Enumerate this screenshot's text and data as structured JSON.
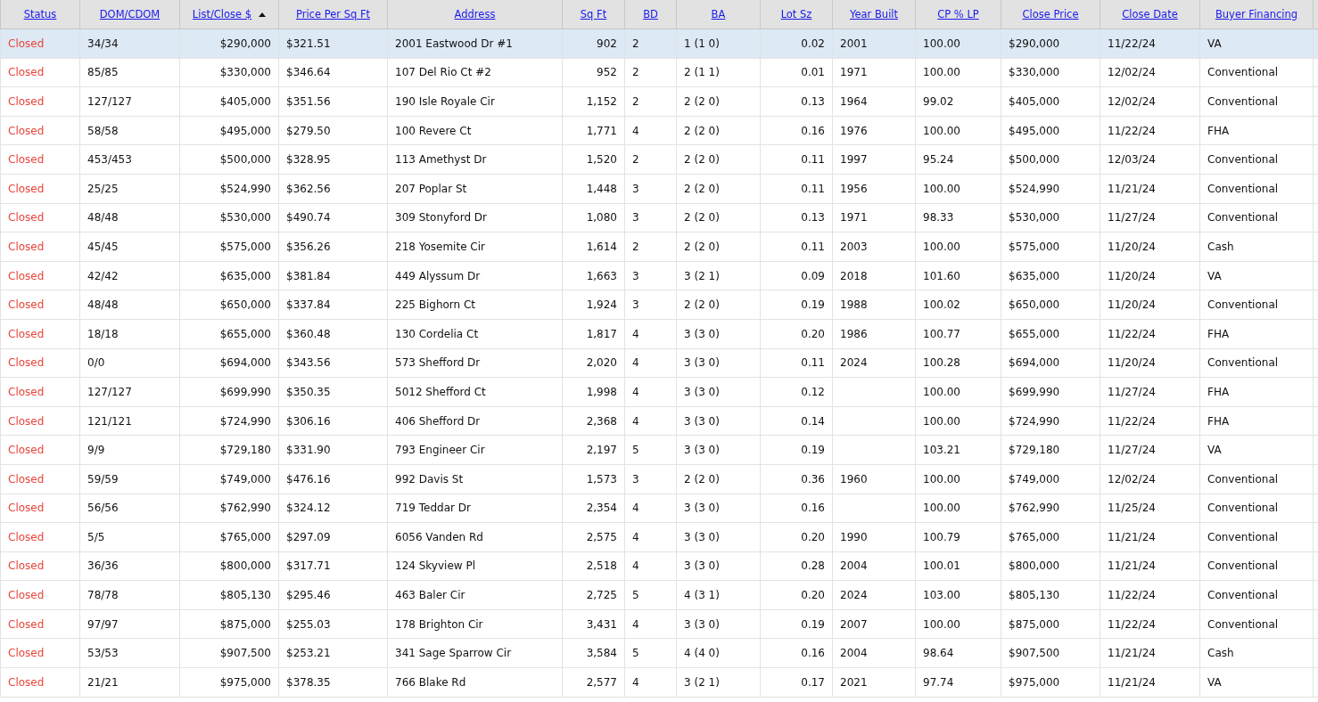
{
  "table": {
    "columns": [
      {
        "label": "Status",
        "kind": "status",
        "sorted": false
      },
      {
        "label": "DOM/CDOM",
        "kind": "text",
        "sorted": false
      },
      {
        "label": "List/Close $",
        "kind": "number",
        "sorted": true
      },
      {
        "label": "Price Per Sq Ft",
        "kind": "text",
        "sorted": false
      },
      {
        "label": "Address",
        "kind": "text",
        "sorted": false
      },
      {
        "label": "Sq Ft",
        "kind": "number",
        "sorted": false
      },
      {
        "label": "BD",
        "kind": "text",
        "sorted": false
      },
      {
        "label": "BA",
        "kind": "text",
        "sorted": false
      },
      {
        "label": "Lot Sz",
        "kind": "number",
        "sorted": false
      },
      {
        "label": "Year Built",
        "kind": "text",
        "sorted": false
      },
      {
        "label": "CP % LP",
        "kind": "text",
        "sorted": false
      },
      {
        "label": "Close Price",
        "kind": "text",
        "sorted": false
      },
      {
        "label": "Close Date",
        "kind": "text",
        "sorted": false
      },
      {
        "label": "Buyer Financing",
        "kind": "text",
        "sorted": false
      }
    ],
    "rows": [
      {
        "selected": true,
        "cells": [
          "Closed",
          "34/34",
          "$290,000",
          "$321.51",
          "2001 Eastwood Dr #1",
          "902",
          "2",
          "1 (1 0)",
          "0.02",
          "2001",
          "100.00",
          "$290,000",
          "11/22/24",
          "VA"
        ]
      },
      {
        "selected": false,
        "cells": [
          "Closed",
          "85/85",
          "$330,000",
          "$346.64",
          "107 Del Rio Ct #2",
          "952",
          "2",
          "2 (1 1)",
          "0.01",
          "1971",
          "100.00",
          "$330,000",
          "12/02/24",
          "Conventional"
        ]
      },
      {
        "selected": false,
        "cells": [
          "Closed",
          "127/127",
          "$405,000",
          "$351.56",
          "190 Isle Royale Cir",
          "1,152",
          "2",
          "2 (2 0)",
          "0.13",
          "1964",
          "99.02",
          "$405,000",
          "12/02/24",
          "Conventional"
        ]
      },
      {
        "selected": false,
        "cells": [
          "Closed",
          "58/58",
          "$495,000",
          "$279.50",
          "100 Revere Ct",
          "1,771",
          "4",
          "2 (2 0)",
          "0.16",
          "1976",
          "100.00",
          "$495,000",
          "11/22/24",
          "FHA"
        ]
      },
      {
        "selected": false,
        "cells": [
          "Closed",
          "453/453",
          "$500,000",
          "$328.95",
          "113 Amethyst Dr",
          "1,520",
          "2",
          "2 (2 0)",
          "0.11",
          "1997",
          "95.24",
          "$500,000",
          "12/03/24",
          "Conventional"
        ]
      },
      {
        "selected": false,
        "cells": [
          "Closed",
          "25/25",
          "$524,990",
          "$362.56",
          "207 Poplar St",
          "1,448",
          "3",
          "2 (2 0)",
          "0.11",
          "1956",
          "100.00",
          "$524,990",
          "11/21/24",
          "Conventional"
        ]
      },
      {
        "selected": false,
        "cells": [
          "Closed",
          "48/48",
          "$530,000",
          "$490.74",
          "309 Stonyford Dr",
          "1,080",
          "3",
          "2 (2 0)",
          "0.13",
          "1971",
          "98.33",
          "$530,000",
          "11/27/24",
          "Conventional"
        ]
      },
      {
        "selected": false,
        "cells": [
          "Closed",
          "45/45",
          "$575,000",
          "$356.26",
          "218 Yosemite Cir",
          "1,614",
          "2",
          "2 (2 0)",
          "0.11",
          "2003",
          "100.00",
          "$575,000",
          "11/20/24",
          "Cash"
        ]
      },
      {
        "selected": false,
        "cells": [
          "Closed",
          "42/42",
          "$635,000",
          "$381.84",
          "449 Alyssum Dr",
          "1,663",
          "3",
          "3 (2 1)",
          "0.09",
          "2018",
          "101.60",
          "$635,000",
          "11/20/24",
          "VA"
        ]
      },
      {
        "selected": false,
        "cells": [
          "Closed",
          "48/48",
          "$650,000",
          "$337.84",
          "225 Bighorn Ct",
          "1,924",
          "3",
          "2 (2 0)",
          "0.19",
          "1988",
          "100.02",
          "$650,000",
          "11/20/24",
          "Conventional"
        ]
      },
      {
        "selected": false,
        "cells": [
          "Closed",
          "18/18",
          "$655,000",
          "$360.48",
          "130 Cordelia Ct",
          "1,817",
          "4",
          "3 (3 0)",
          "0.20",
          "1986",
          "100.77",
          "$655,000",
          "11/22/24",
          "FHA"
        ]
      },
      {
        "selected": false,
        "cells": [
          "Closed",
          "0/0",
          "$694,000",
          "$343.56",
          "573 Shefford Dr",
          "2,020",
          "4",
          "3 (3 0)",
          "0.11",
          "2024",
          "100.28",
          "$694,000",
          "11/20/24",
          "Conventional"
        ]
      },
      {
        "selected": false,
        "cells": [
          "Closed",
          "127/127",
          "$699,990",
          "$350.35",
          "5012 Shefford Ct",
          "1,998",
          "4",
          "3 (3 0)",
          "0.12",
          null,
          "100.00",
          "$699,990",
          "11/27/24",
          "FHA"
        ]
      },
      {
        "selected": false,
        "cells": [
          "Closed",
          "121/121",
          "$724,990",
          "$306.16",
          "406 Shefford Dr",
          "2,368",
          "4",
          "3 (3 0)",
          "0.14",
          null,
          "100.00",
          "$724,990",
          "11/22/24",
          "FHA"
        ]
      },
      {
        "selected": false,
        "cells": [
          "Closed",
          "9/9",
          "$729,180",
          "$331.90",
          "793 Engineer Cir",
          "2,197",
          "5",
          "3 (3 0)",
          "0.19",
          null,
          "103.21",
          "$729,180",
          "11/27/24",
          "VA"
        ]
      },
      {
        "selected": false,
        "cells": [
          "Closed",
          "59/59",
          "$749,000",
          "$476.16",
          "992 Davis St",
          "1,573",
          "3",
          "2 (2 0)",
          "0.36",
          "1960",
          "100.00",
          "$749,000",
          "12/02/24",
          "Conventional"
        ]
      },
      {
        "selected": false,
        "cells": [
          "Closed",
          "56/56",
          "$762,990",
          "$324.12",
          "719 Teddar Dr",
          "2,354",
          "4",
          "3 (3 0)",
          "0.16",
          null,
          "100.00",
          "$762,990",
          "11/25/24",
          "Conventional"
        ]
      },
      {
        "selected": false,
        "cells": [
          "Closed",
          "5/5",
          "$765,000",
          "$297.09",
          "6056 Vanden Rd",
          "2,575",
          "4",
          "3 (3 0)",
          "0.20",
          "1990",
          "100.79",
          "$765,000",
          "11/21/24",
          "Conventional"
        ]
      },
      {
        "selected": false,
        "cells": [
          "Closed",
          "36/36",
          "$800,000",
          "$317.71",
          "124 Skyview Pl",
          "2,518",
          "4",
          "3 (3 0)",
          "0.28",
          "2004",
          "100.01",
          "$800,000",
          "11/21/24",
          "Conventional"
        ]
      },
      {
        "selected": false,
        "cells": [
          "Closed",
          "78/78",
          "$805,130",
          "$295.46",
          "463 Baler Cir",
          "2,725",
          "5",
          "4 (3 1)",
          "0.20",
          "2024",
          "103.00",
          "$805,130",
          "11/22/24",
          "Conventional"
        ]
      },
      {
        "selected": false,
        "cells": [
          "Closed",
          "97/97",
          "$875,000",
          "$255.03",
          "178 Brighton Cir",
          "3,431",
          "4",
          "3 (3 0)",
          "0.19",
          "2007",
          "100.00",
          "$875,000",
          "11/22/24",
          "Conventional"
        ]
      },
      {
        "selected": false,
        "cells": [
          "Closed",
          "53/53",
          "$907,500",
          "$253.21",
          "341 Sage Sparrow Cir",
          "3,584",
          "5",
          "4 (4 0)",
          "0.16",
          "2004",
          "98.64",
          "$907,500",
          "11/21/24",
          "Cash"
        ]
      },
      {
        "selected": false,
        "cells": [
          "Closed",
          "21/21",
          "$975,000",
          "$378.35",
          "766 Blake Rd",
          "2,577",
          "4",
          "3 (2 1)",
          "0.17",
          "2021",
          "97.74",
          "$975,000",
          "11/21/24",
          "VA"
        ]
      }
    ]
  }
}
